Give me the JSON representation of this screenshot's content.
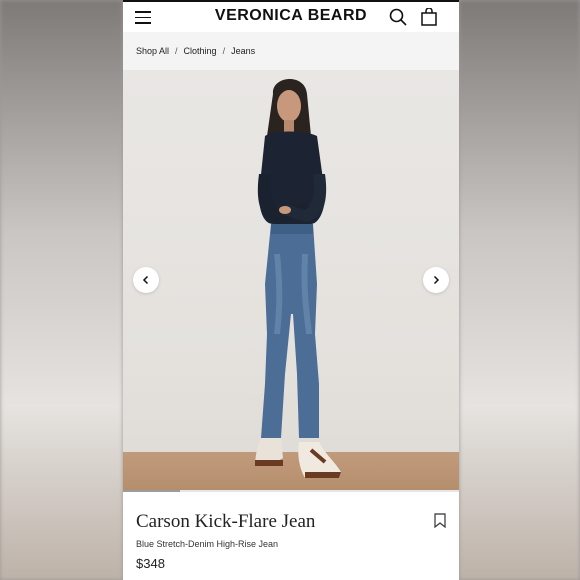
{
  "header": {
    "brand": "VERONICA BEARD",
    "menu_icon": "hamburger-icon",
    "search_icon": "search-icon",
    "bag_icon": "shopping-bag-icon"
  },
  "breadcrumb": {
    "items": [
      "Shop All",
      "Clothing",
      "Jeans"
    ],
    "separator": "/"
  },
  "gallery": {
    "prev_icon": "chevron-left-icon",
    "next_icon": "chevron-right-icon",
    "progress_fraction": 0.17
  },
  "product": {
    "name": "Carson Kick-Flare Jean",
    "description": "Blue Stretch-Denim High-Rise Jean",
    "price": "$348",
    "wishlist_icon": "bookmark-icon"
  }
}
